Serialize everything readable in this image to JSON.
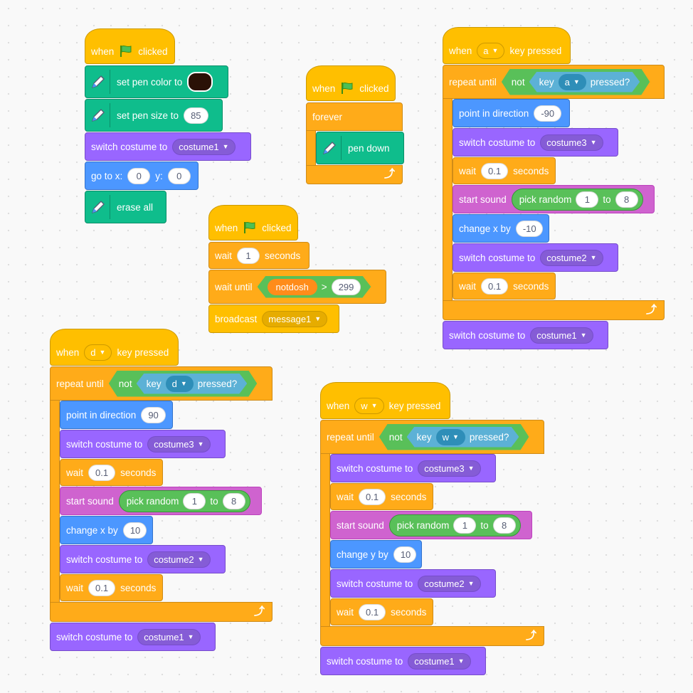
{
  "scripts": {
    "pen_setup": {
      "hat": {
        "when": "when",
        "clicked": "clicked",
        "flag_icon": "green-flag"
      },
      "set_color": {
        "label": "set pen color to",
        "color": "#2a1106"
      },
      "set_size": {
        "label": "set pen size to",
        "value": "85"
      },
      "switch_costume": {
        "label": "switch costume to",
        "value": "costume1"
      },
      "goto": {
        "x_label": "go to x:",
        "x": "0",
        "y_label": "y:",
        "y": "0"
      },
      "erase": {
        "label": "erase all"
      }
    },
    "pen_loop": {
      "hat": {
        "when": "when",
        "clicked": "clicked"
      },
      "forever": "forever",
      "pen_down": "pen down"
    },
    "broadcast_script": {
      "hat": {
        "when": "when",
        "clicked": "clicked"
      },
      "wait": {
        "label": "wait",
        "value": "1",
        "unit": "seconds"
      },
      "wait_until": {
        "label": "wait until",
        "variable": "notdosh",
        "op": ">",
        "value": "299"
      },
      "broadcast": {
        "label": "broadcast",
        "message": "message1"
      }
    },
    "key_a": {
      "hat": {
        "when": "when",
        "key": "a",
        "key_pressed": "key pressed"
      },
      "repeat_until": {
        "label": "repeat until",
        "not": "not",
        "key": "key",
        "key_value": "a",
        "pressed": "pressed?"
      },
      "point": {
        "label": "point in direction",
        "value": "-90"
      },
      "costume3": {
        "label": "switch costume to",
        "value": "costume3"
      },
      "wait1": {
        "label": "wait",
        "value": "0.1",
        "unit": "seconds"
      },
      "sound": {
        "label": "start sound",
        "random": "pick random",
        "from": "1",
        "to_label": "to",
        "to": "8"
      },
      "change": {
        "label": "change x by",
        "value": "-10"
      },
      "costume2": {
        "label": "switch costume to",
        "value": "costume2"
      },
      "wait2": {
        "label": "wait",
        "value": "0.1",
        "unit": "seconds"
      },
      "after": {
        "label": "switch costume to",
        "value": "costume1"
      }
    },
    "key_d": {
      "hat": {
        "when": "when",
        "key": "d",
        "key_pressed": "key pressed"
      },
      "repeat_until": {
        "label": "repeat until",
        "not": "not",
        "key": "key",
        "key_value": "d",
        "pressed": "pressed?"
      },
      "point": {
        "label": "point in direction",
        "value": "90"
      },
      "costume3": {
        "label": "switch costume to",
        "value": "costume3"
      },
      "wait1": {
        "label": "wait",
        "value": "0.1",
        "unit": "seconds"
      },
      "sound": {
        "label": "start sound",
        "random": "pick random",
        "from": "1",
        "to_label": "to",
        "to": "8"
      },
      "change": {
        "label": "change x by",
        "value": "10"
      },
      "costume2": {
        "label": "switch costume to",
        "value": "costume2"
      },
      "wait2": {
        "label": "wait",
        "value": "0.1",
        "unit": "seconds"
      },
      "after": {
        "label": "switch costume to",
        "value": "costume1"
      }
    },
    "key_w": {
      "hat": {
        "when": "when",
        "key": "w",
        "key_pressed": "key pressed"
      },
      "repeat_until": {
        "label": "repeat until",
        "not": "not",
        "key": "key",
        "key_value": "w",
        "pressed": "pressed?"
      },
      "costume3": {
        "label": "switch costume to",
        "value": "costume3"
      },
      "wait1": {
        "label": "wait",
        "value": "0.1",
        "unit": "seconds"
      },
      "sound": {
        "label": "start sound",
        "random": "pick random",
        "from": "1",
        "to_label": "to",
        "to": "8"
      },
      "change": {
        "label": "change y by",
        "value": "10"
      },
      "costume2": {
        "label": "switch costume to",
        "value": "costume2"
      },
      "wait2": {
        "label": "wait",
        "value": "0.1",
        "unit": "seconds"
      },
      "after": {
        "label": "switch costume to",
        "value": "costume1"
      }
    }
  },
  "icons": {
    "flag": "green-flag-icon",
    "pen": "pen-icon",
    "loop": "loop-arrow-icon",
    "dropdown": "caret-down-icon"
  }
}
